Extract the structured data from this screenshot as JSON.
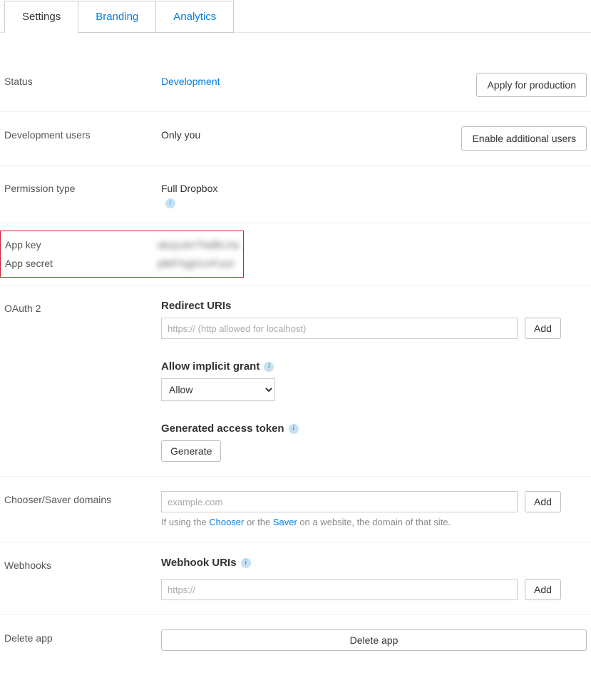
{
  "tabs": {
    "settings": "Settings",
    "branding": "Branding",
    "analytics": "Analytics"
  },
  "status": {
    "label": "Status",
    "value": "Development",
    "apply_btn": "Apply for production"
  },
  "devusers": {
    "label": "Development users",
    "value": "Only you",
    "enable_btn": "Enable additional users"
  },
  "permission": {
    "label": "Permission type",
    "value": "Full Dropbox"
  },
  "keys": {
    "appkey_label": "App key",
    "appkey_value": "abcjushrTNdBLHa",
    "appsecret_label": "App secret",
    "appsecret_value": "jdklFSgjGcnFuxd"
  },
  "oauth": {
    "label": "OAuth 2",
    "redirect_heading": "Redirect URIs",
    "redirect_placeholder": "https:// (http allowed for localhost)",
    "add_btn": "Add",
    "implicit_heading": "Allow implicit grant",
    "implicit_value": "Allow",
    "token_heading": "Generated access token",
    "generate_btn": "Generate"
  },
  "chooser": {
    "label": "Chooser/Saver domains",
    "placeholder": "example.com",
    "add_btn": "Add",
    "hint_prefix": "If using the ",
    "hint_link1": "Chooser",
    "hint_mid": " or the ",
    "hint_link2": "Saver",
    "hint_suffix": " on a website, the domain of that site."
  },
  "webhooks": {
    "label": "Webhooks",
    "heading": "Webhook URIs",
    "placeholder": "https://",
    "add_btn": "Add"
  },
  "delete": {
    "label": "Delete app",
    "btn": "Delete app"
  }
}
